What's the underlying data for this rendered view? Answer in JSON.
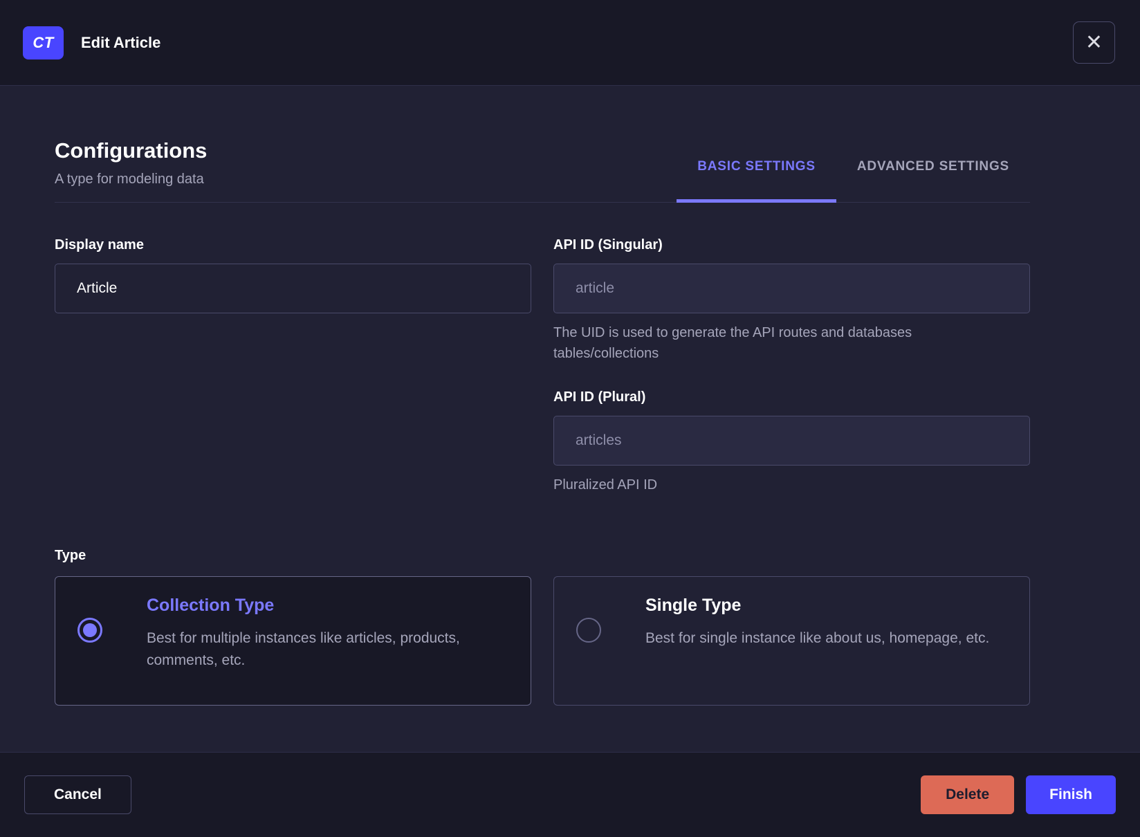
{
  "header": {
    "badge": "CT",
    "title": "Edit Article",
    "close_icon": "✕"
  },
  "config": {
    "title": "Configurations",
    "subtitle": "A type for modeling data",
    "tabs": [
      {
        "label": "BASIC SETTINGS",
        "active": true
      },
      {
        "label": "ADVANCED SETTINGS",
        "active": false
      }
    ]
  },
  "fields": {
    "display_name": {
      "label": "Display name",
      "value": "Article"
    },
    "api_id_singular": {
      "label": "API ID (Singular)",
      "value": "article",
      "hint": "The UID is used to generate the API routes and databases tables/collections"
    },
    "api_id_plural": {
      "label": "API ID (Plural)",
      "value": "articles",
      "hint": "Pluralized API ID"
    }
  },
  "type_section": {
    "label": "Type",
    "options": [
      {
        "title": "Collection Type",
        "description": "Best for multiple instances like articles, products, comments, etc.",
        "selected": true
      },
      {
        "title": "Single Type",
        "description": "Best for single instance like about us, homepage, etc.",
        "selected": false
      }
    ]
  },
  "footer": {
    "cancel_label": "Cancel",
    "delete_label": "Delete",
    "finish_label": "Finish"
  },
  "colors": {
    "accent": "#4945ff",
    "accent_light": "#7b79ff",
    "danger": "#dd6a56",
    "body_bg": "#212134",
    "panel_bg": "#181826",
    "border": "#4a4a6a",
    "text_muted": "#a5a5ba"
  }
}
